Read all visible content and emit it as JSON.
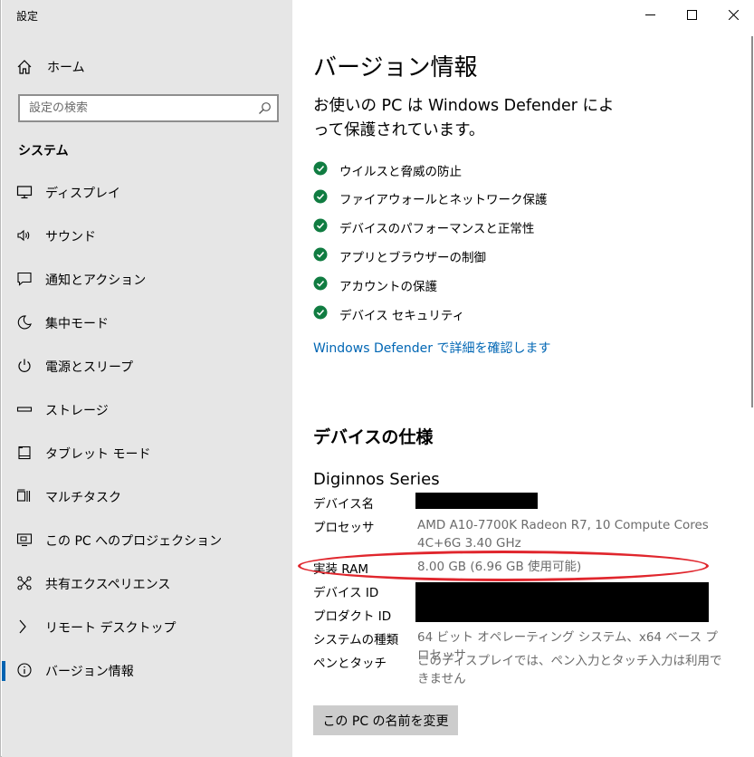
{
  "window": {
    "title": "設定"
  },
  "sidebar": {
    "home_label": "ホーム",
    "search_placeholder": "設定の検索",
    "section_title": "システム",
    "items": [
      {
        "label": "ディスプレイ",
        "icon": "display-icon"
      },
      {
        "label": "サウンド",
        "icon": "sound-icon"
      },
      {
        "label": "通知とアクション",
        "icon": "notifications-icon"
      },
      {
        "label": "集中モード",
        "icon": "focus-moon-icon"
      },
      {
        "label": "電源とスリープ",
        "icon": "power-icon"
      },
      {
        "label": "ストレージ",
        "icon": "storage-icon"
      },
      {
        "label": "タブレット モード",
        "icon": "tablet-icon"
      },
      {
        "label": "マルチタスク",
        "icon": "multitask-icon"
      },
      {
        "label": "この PC へのプロジェクション",
        "icon": "projection-icon"
      },
      {
        "label": "共有エクスペリエンス",
        "icon": "share-icon"
      },
      {
        "label": "リモート デスクトップ",
        "icon": "remote-icon"
      },
      {
        "label": "バージョン情報",
        "icon": "info-icon",
        "active": true
      }
    ]
  },
  "main": {
    "title": "バージョン情報",
    "protection_text": "お使いの PC は Windows Defender によって保護されています。",
    "protections": [
      "ウイルスと脅威の防止",
      "ファイアウォールとネットワーク保護",
      "デバイスのパフォーマンスと正常性",
      "アプリとブラウザーの制御",
      "アカウントの保護",
      "デバイス セキュリティ"
    ],
    "defender_link": "Windows Defender で詳細を確認します",
    "specs_title": "デバイスの仕様",
    "device_title": "Diginnos Series",
    "specs": {
      "device_name_label": "デバイス名",
      "processor_label": "プロセッサ",
      "processor_value": "AMD A10-7700K Radeon R7, 10 Compute Cores 4C+6G 3.40 GHz",
      "ram_label": "実装 RAM",
      "ram_value": "8.00 GB (6.96 GB 使用可能)",
      "device_id_label": "デバイス ID",
      "product_id_label": "プロダクト ID",
      "system_type_label": "システムの種類",
      "system_type_value": "64 ビット オペレーティング システム、x64 ベース プロセッサ",
      "pen_label": "ペンとタッチ",
      "pen_value": "このディスプレイでは、ペン入力とタッチ入力は利用できません"
    },
    "rename_button": "この PC の名前を変更"
  },
  "colors": {
    "sidebar_bg": "#e6e6e6",
    "accent": "#0063b1",
    "link": "#0066b4",
    "check_green": "#107c41",
    "highlight_red": "#e0262d"
  }
}
